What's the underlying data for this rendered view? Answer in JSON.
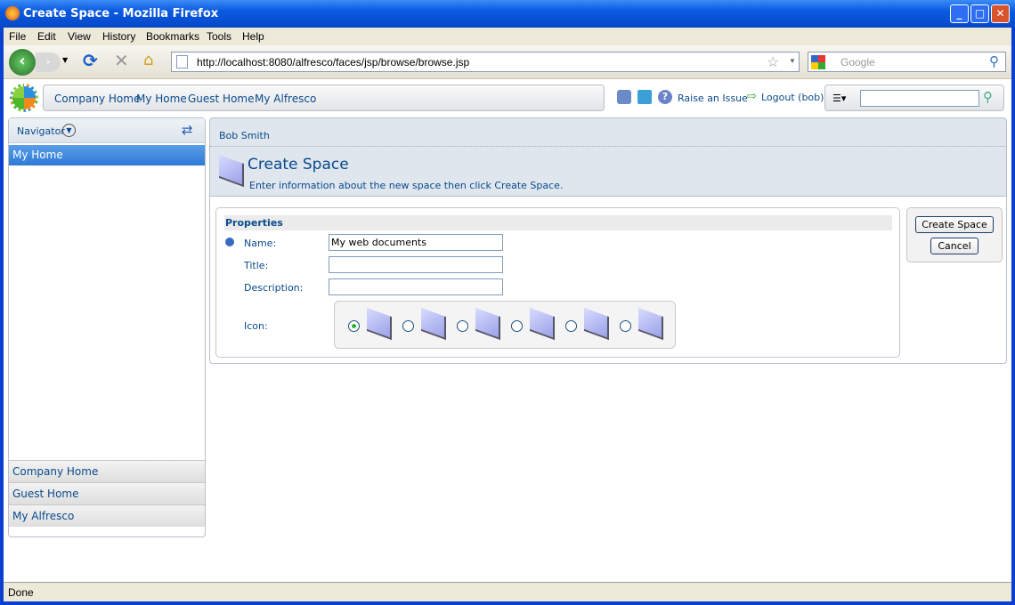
{
  "window": {
    "title": "Create Space - Mozilla Firefox"
  },
  "menu": [
    "File",
    "Edit",
    "View",
    "History",
    "Bookmarks",
    "Tools",
    "Help"
  ],
  "toolbar": {
    "url": "http://localhost:8080/alfresco/faces/jsp/browse/browse.jsp",
    "search_placeholder": "Google"
  },
  "header": {
    "breadcrumbs": [
      "Company Home",
      "My Home",
      "Guest Home",
      "My Alfresco"
    ],
    "raise_issue": "Raise an Issue",
    "logout": "Logout (bob)",
    "search_value": ""
  },
  "navigator": {
    "title": "Navigator",
    "selected": "My Home",
    "bottom_items": [
      "Company Home",
      "Guest Home",
      "My Alfresco"
    ]
  },
  "main": {
    "user": "Bob Smith",
    "title": "Create Space",
    "subtitle": "Enter information about the new space then click Create Space.",
    "section": "Properties",
    "fields": {
      "name_label": "Name:",
      "name_value": "My web documents",
      "title_label": "Title:",
      "title_value": "",
      "description_label": "Description:",
      "description_value": "",
      "icon_label": "Icon:"
    },
    "icon_options": [
      "space-icon-default",
      "space-icon-sun",
      "space-icon-document",
      "space-icon-pencil",
      "space-icon-cd",
      "space-icon-image"
    ],
    "selected_icon": 0,
    "create_button": "Create Space",
    "cancel_button": "Cancel"
  },
  "status": {
    "text": "Done"
  }
}
